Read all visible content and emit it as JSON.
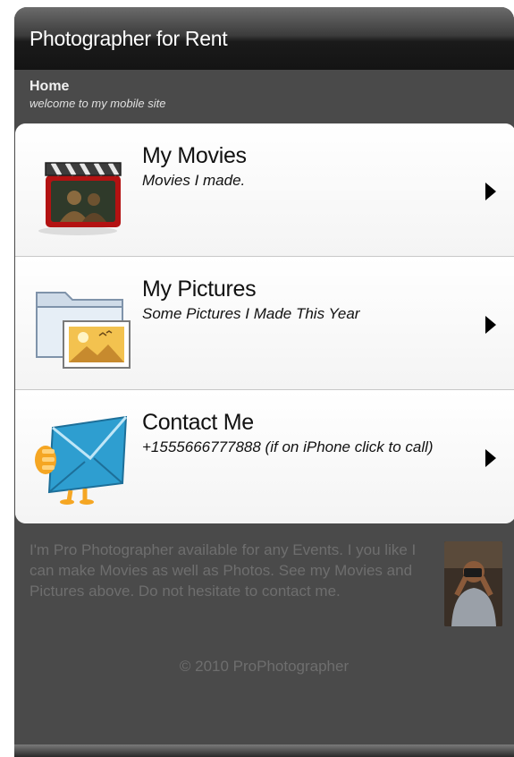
{
  "header": {
    "title": "Photographer for Rent"
  },
  "page": {
    "name": "Home",
    "tagline": "welcome to my mobile site"
  },
  "menu": {
    "items": [
      {
        "label": "My Movies",
        "desc": "Movies I made.",
        "icon": "movie-clapper-icon"
      },
      {
        "label": "My Pictures",
        "desc": "Some Pictures I Made This Year",
        "icon": "picture-folder-icon"
      },
      {
        "label": "Contact Me",
        "desc": "+1555666777888 (if on iPhone click to call)",
        "icon": "envelope-icon"
      }
    ]
  },
  "about": {
    "text": "I'm Pro Photographer available for any Events. I you like I can make Movies as well as Photos. See my Movies and Pictures above. Do not hesitate to contact me."
  },
  "footer": {
    "copyright": "© 2010 ProPhotographer"
  }
}
